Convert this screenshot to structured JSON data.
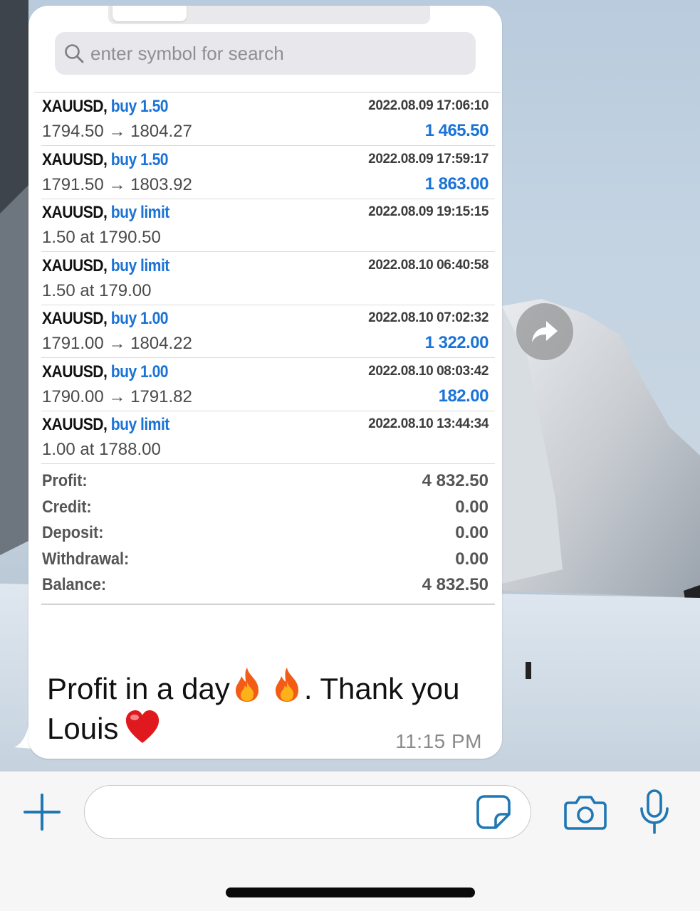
{
  "search": {
    "placeholder": "enter symbol for search"
  },
  "trades": [
    {
      "symbol": "XAUUSD,",
      "type": "buy 1.50",
      "detail": "1794.50 → 1804.27",
      "time": "2022.08.09 17:06:10",
      "profit": "1 465.50"
    },
    {
      "symbol": "XAUUSD,",
      "type": "buy 1.50",
      "detail": "1791.50 → 1803.92",
      "time": "2022.08.09 17:59:17",
      "profit": "1 863.00"
    },
    {
      "symbol": "XAUUSD,",
      "type": "buy limit",
      "detail": "1.50 at 1790.50",
      "time": "2022.08.09 19:15:15",
      "profit": ""
    },
    {
      "symbol": "XAUUSD,",
      "type": "buy limit",
      "detail": "1.50 at 179.00",
      "time": "2022.08.10 06:40:58",
      "profit": ""
    },
    {
      "symbol": "XAUUSD,",
      "type": "buy 1.00",
      "detail": "1791.00 → 1804.22",
      "time": "2022.08.10 07:02:32",
      "profit": "1 322.00"
    },
    {
      "symbol": "XAUUSD,",
      "type": "buy 1.00",
      "detail": "1790.00 → 1791.82",
      "time": "2022.08.10 08:03:42",
      "profit": "182.00"
    },
    {
      "symbol": "XAUUSD,",
      "type": "buy limit",
      "detail": "1.00 at 1788.00",
      "time": "2022.08.10 13:44:34",
      "profit": ""
    }
  ],
  "summary": [
    {
      "label": "Profit:",
      "value": "4 832.50"
    },
    {
      "label": "Credit:",
      "value": "0.00"
    },
    {
      "label": "Deposit:",
      "value": "0.00"
    },
    {
      "label": "Withdrawal:",
      "value": "0.00"
    },
    {
      "label": "Balance:",
      "value": "4 832.50"
    }
  ],
  "message": {
    "text_part1": "Profit in a day",
    "text_part2": ". Thank you",
    "text_part3": "Louis",
    "emojis": [
      "fire-icon",
      "fire-icon",
      "red-heart-icon"
    ],
    "time": "11:15 PM"
  },
  "colors": {
    "accent_blue": "#1a73d6",
    "whatsapp_icon_blue": "#1f77b4",
    "bubble": "#ffffff"
  },
  "input_bar": {
    "icons": [
      "plus-icon",
      "sticker-icon",
      "camera-icon",
      "microphone-icon"
    ]
  }
}
